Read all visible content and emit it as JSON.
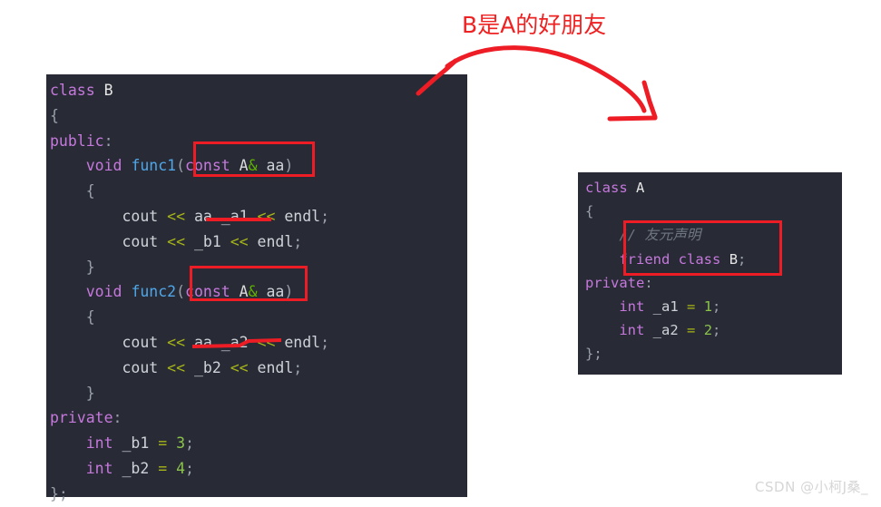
{
  "annotation": {
    "title": "B是A的好朋友",
    "title_color": "#ee2222",
    "box_color": "#ee1c25",
    "arrow_color": "#ee1c25"
  },
  "watermark": {
    "text": "CSDN @小柯J桑_"
  },
  "code_panel_b": {
    "background": "#282b35",
    "lines": [
      {
        "id": "b-l1",
        "tokens": [
          {
            "t": "class",
            "c": "k-kw"
          },
          {
            "t": " ",
            "c": "k-plain"
          },
          {
            "t": "B",
            "c": "k-white"
          }
        ]
      },
      {
        "id": "b-l2",
        "tokens": [
          {
            "t": "{",
            "c": "k-punct"
          }
        ]
      },
      {
        "id": "b-l3",
        "tokens": [
          {
            "t": "public",
            "c": "k-kw"
          },
          {
            "t": ":",
            "c": "k-punct"
          }
        ]
      },
      {
        "id": "b-l4",
        "tokens": [
          {
            "t": "    ",
            "c": "k-plain"
          },
          {
            "t": "void",
            "c": "k-kw"
          },
          {
            "t": " ",
            "c": "k-plain"
          },
          {
            "t": "func1",
            "c": "k-fn"
          },
          {
            "t": "(",
            "c": "k-punct"
          },
          {
            "t": "const",
            "c": "k-kw"
          },
          {
            "t": " ",
            "c": "k-plain"
          },
          {
            "t": "A",
            "c": "k-type"
          },
          {
            "t": "&",
            "c": "k-amp"
          },
          {
            "t": " aa",
            "c": "k-plain"
          },
          {
            "t": ")",
            "c": "k-punct"
          }
        ]
      },
      {
        "id": "b-l5",
        "tokens": [
          {
            "t": "    ",
            "c": "k-plain"
          },
          {
            "t": "{",
            "c": "k-punct"
          }
        ]
      },
      {
        "id": "b-l6",
        "tokens": [
          {
            "t": "        ",
            "c": "k-plain"
          },
          {
            "t": "cout",
            "c": "k-plain"
          },
          {
            "t": " ",
            "c": "k-plain"
          },
          {
            "t": "<<",
            "c": "k-op"
          },
          {
            "t": " aa._a1 ",
            "c": "k-plain"
          },
          {
            "t": "<<",
            "c": "k-op"
          },
          {
            "t": " endl",
            "c": "k-plain"
          },
          {
            "t": ";",
            "c": "k-punct"
          }
        ]
      },
      {
        "id": "b-l7",
        "tokens": [
          {
            "t": "        ",
            "c": "k-plain"
          },
          {
            "t": "cout",
            "c": "k-plain"
          },
          {
            "t": " ",
            "c": "k-plain"
          },
          {
            "t": "<<",
            "c": "k-op"
          },
          {
            "t": " _b1 ",
            "c": "k-plain"
          },
          {
            "t": "<<",
            "c": "k-op"
          },
          {
            "t": " endl",
            "c": "k-plain"
          },
          {
            "t": ";",
            "c": "k-punct"
          }
        ]
      },
      {
        "id": "b-l8",
        "tokens": [
          {
            "t": "    ",
            "c": "k-plain"
          },
          {
            "t": "}",
            "c": "k-punct"
          }
        ]
      },
      {
        "id": "b-l9",
        "tokens": [
          {
            "t": "    ",
            "c": "k-plain"
          },
          {
            "t": "void",
            "c": "k-kw"
          },
          {
            "t": " ",
            "c": "k-plain"
          },
          {
            "t": "func2",
            "c": "k-fn"
          },
          {
            "t": "(",
            "c": "k-punct"
          },
          {
            "t": "const",
            "c": "k-kw"
          },
          {
            "t": " ",
            "c": "k-plain"
          },
          {
            "t": "A",
            "c": "k-type"
          },
          {
            "t": "&",
            "c": "k-amp"
          },
          {
            "t": " aa",
            "c": "k-plain"
          },
          {
            "t": ")",
            "c": "k-punct"
          }
        ]
      },
      {
        "id": "b-l10",
        "tokens": [
          {
            "t": "    ",
            "c": "k-plain"
          },
          {
            "t": "{",
            "c": "k-punct"
          }
        ]
      },
      {
        "id": "b-l11",
        "tokens": [
          {
            "t": "        ",
            "c": "k-plain"
          },
          {
            "t": "cout",
            "c": "k-plain"
          },
          {
            "t": " ",
            "c": "k-plain"
          },
          {
            "t": "<<",
            "c": "k-op"
          },
          {
            "t": " aa._a2 ",
            "c": "k-plain"
          },
          {
            "t": "<<",
            "c": "k-op"
          },
          {
            "t": " endl",
            "c": "k-plain"
          },
          {
            "t": ";",
            "c": "k-punct"
          }
        ]
      },
      {
        "id": "b-l12",
        "tokens": [
          {
            "t": "        ",
            "c": "k-plain"
          },
          {
            "t": "cout",
            "c": "k-plain"
          },
          {
            "t": " ",
            "c": "k-plain"
          },
          {
            "t": "<<",
            "c": "k-op"
          },
          {
            "t": " _b2 ",
            "c": "k-plain"
          },
          {
            "t": "<<",
            "c": "k-op"
          },
          {
            "t": " endl",
            "c": "k-plain"
          },
          {
            "t": ";",
            "c": "k-punct"
          }
        ]
      },
      {
        "id": "b-l13",
        "tokens": [
          {
            "t": "    ",
            "c": "k-plain"
          },
          {
            "t": "}",
            "c": "k-punct"
          }
        ]
      },
      {
        "id": "b-l14",
        "tokens": [
          {
            "t": "private",
            "c": "k-kw"
          },
          {
            "t": ":",
            "c": "k-punct"
          }
        ]
      },
      {
        "id": "b-l15",
        "tokens": [
          {
            "t": "    ",
            "c": "k-plain"
          },
          {
            "t": "int",
            "c": "k-kw"
          },
          {
            "t": " _b1 ",
            "c": "k-plain"
          },
          {
            "t": "=",
            "c": "k-op"
          },
          {
            "t": " ",
            "c": "k-plain"
          },
          {
            "t": "3",
            "c": "k-num"
          },
          {
            "t": ";",
            "c": "k-punct"
          }
        ]
      },
      {
        "id": "b-l16",
        "tokens": [
          {
            "t": "    ",
            "c": "k-plain"
          },
          {
            "t": "int",
            "c": "k-kw"
          },
          {
            "t": " _b2 ",
            "c": "k-plain"
          },
          {
            "t": "=",
            "c": "k-op"
          },
          {
            "t": " ",
            "c": "k-plain"
          },
          {
            "t": "4",
            "c": "k-num"
          },
          {
            "t": ";",
            "c": "k-punct"
          }
        ]
      },
      {
        "id": "b-l17",
        "tokens": [
          {
            "t": "};",
            "c": "k-punct"
          }
        ]
      }
    ]
  },
  "code_panel_a": {
    "background": "#282b35",
    "lines": [
      {
        "id": "a-l1",
        "tokens": [
          {
            "t": "class",
            "c": "k-kw"
          },
          {
            "t": " ",
            "c": "k-plain"
          },
          {
            "t": "A",
            "c": "k-white"
          }
        ]
      },
      {
        "id": "a-l2",
        "tokens": [
          {
            "t": "{",
            "c": "k-punct"
          }
        ]
      },
      {
        "id": "a-l3",
        "tokens": [
          {
            "t": "    ",
            "c": "k-plain"
          },
          {
            "t": "// 友元声明",
            "c": "k-comment"
          }
        ]
      },
      {
        "id": "a-l4",
        "tokens": [
          {
            "t": "    ",
            "c": "k-plain"
          },
          {
            "t": "friend",
            "c": "k-kw"
          },
          {
            "t": " ",
            "c": "k-plain"
          },
          {
            "t": "class",
            "c": "k-kw"
          },
          {
            "t": " ",
            "c": "k-plain"
          },
          {
            "t": "B",
            "c": "k-white"
          },
          {
            "t": ";",
            "c": "k-punct"
          }
        ]
      },
      {
        "id": "a-l5",
        "tokens": [
          {
            "t": "private",
            "c": "k-kw"
          },
          {
            "t": ":",
            "c": "k-punct"
          }
        ]
      },
      {
        "id": "a-l6",
        "tokens": [
          {
            "t": "    ",
            "c": "k-plain"
          },
          {
            "t": "int",
            "c": "k-kw"
          },
          {
            "t": " _a1 ",
            "c": "k-plain"
          },
          {
            "t": "=",
            "c": "k-op"
          },
          {
            "t": " ",
            "c": "k-plain"
          },
          {
            "t": "1",
            "c": "k-num"
          },
          {
            "t": ";",
            "c": "k-punct"
          }
        ]
      },
      {
        "id": "a-l7",
        "tokens": [
          {
            "t": "    ",
            "c": "k-plain"
          },
          {
            "t": "int",
            "c": "k-kw"
          },
          {
            "t": " _a2 ",
            "c": "k-plain"
          },
          {
            "t": "=",
            "c": "k-op"
          },
          {
            "t": " ",
            "c": "k-plain"
          },
          {
            "t": "2",
            "c": "k-num"
          },
          {
            "t": ";",
            "c": "k-punct"
          }
        ]
      },
      {
        "id": "a-l8",
        "tokens": [
          {
            "t": "};",
            "c": "k-punct"
          }
        ]
      }
    ]
  }
}
